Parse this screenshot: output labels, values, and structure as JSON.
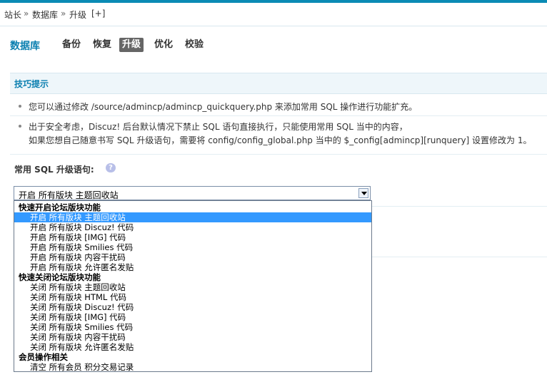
{
  "breadcrumb": {
    "items": [
      "站长",
      "数据库",
      "升级"
    ],
    "separator": "»",
    "add_label": "[+]"
  },
  "nav": {
    "title": "数据库",
    "tabs": [
      {
        "label": "备份",
        "active": false
      },
      {
        "label": "恢复",
        "active": false
      },
      {
        "label": "升级",
        "active": true
      },
      {
        "label": "优化",
        "active": false
      },
      {
        "label": "校验",
        "active": false
      }
    ]
  },
  "tips": {
    "title": "技巧提示",
    "line1": "您可以通过修改 /source/admincp/admincp_quickquery.php 来添加常用 SQL 操作进行功能扩充。",
    "line2": "出于安全考虑，Discuz! 后台默认情况下禁止 SQL 语句直接执行，只能使用常用 SQL 当中的内容，",
    "line3": "如果您想自己随意书写 SQL 升级语句，需要将 config/config_global.php 当中的 $_config[admincp][runquery] 设置修改为 1。"
  },
  "form": {
    "label": "常用 SQL 升级语句:",
    "help_icon": "question-icon",
    "selected": "开启 所有版块 主题回收站",
    "options": [
      {
        "type": "group",
        "label": "快速开启论坛版块功能"
      },
      {
        "type": "option",
        "label": "开启 所有版块 主题回收站",
        "selected": true
      },
      {
        "type": "option",
        "label": "开启 所有版块 Discuz! 代码"
      },
      {
        "type": "option",
        "label": "开启 所有版块 [IMG] 代码"
      },
      {
        "type": "option",
        "label": "开启 所有版块 Smilies 代码"
      },
      {
        "type": "option",
        "label": "开启 所有版块 内容干扰码"
      },
      {
        "type": "option",
        "label": "开启 所有版块 允许匿名发贴"
      },
      {
        "type": "group",
        "label": "快速关闭论坛版块功能"
      },
      {
        "type": "option",
        "label": "关闭 所有版块 主题回收站"
      },
      {
        "type": "option",
        "label": "关闭 所有版块 HTML 代码"
      },
      {
        "type": "option",
        "label": "关闭 所有版块 Discuz! 代码"
      },
      {
        "type": "option",
        "label": "关闭 所有版块 [IMG] 代码"
      },
      {
        "type": "option",
        "label": "关闭 所有版块 Smilies 代码"
      },
      {
        "type": "option",
        "label": "关闭 所有版块 内容干扰码"
      },
      {
        "type": "option",
        "label": "关闭 所有版块 允许匿名发贴"
      },
      {
        "type": "group",
        "label": "会员操作相关"
      },
      {
        "type": "option",
        "label": "清空 所有会员 积分交易记录"
      }
    ]
  }
}
